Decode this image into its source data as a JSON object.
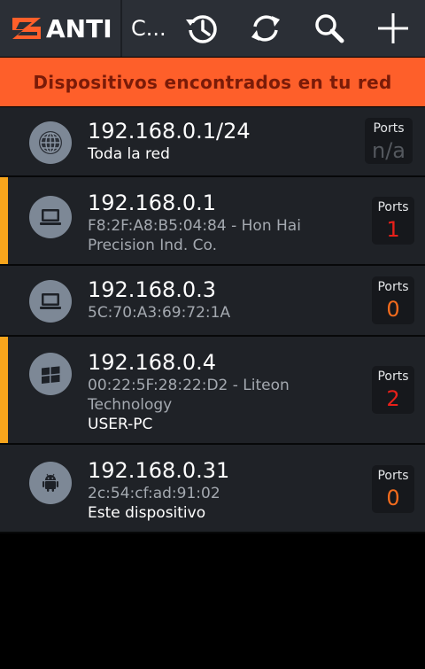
{
  "app": {
    "name": "ANTI",
    "title": "C..."
  },
  "banner": {
    "text": "Dispositivos encontrados en tu red"
  },
  "colors": {
    "accent": "#f7a51c",
    "banner": "#fe5f2a",
    "port_active": "#e8201a",
    "port_zero": "#f26b1d",
    "port_na": "#54585e"
  },
  "ports_label": "Ports",
  "devices": [
    {
      "ip": "192.168.0.1/24",
      "detail": "Toda la red",
      "host": "",
      "ports": "n/a",
      "icon": "globe-icon",
      "flagged": false
    },
    {
      "ip": "192.168.0.1",
      "detail": "F8:2F:A8:B5:04:84 - Hon Hai Precision Ind. Co.",
      "host": "",
      "ports": "1",
      "icon": "computer-icon",
      "flagged": true
    },
    {
      "ip": "192.168.0.3",
      "detail": "5C:70:A3:69:72:1A",
      "host": "",
      "ports": "0",
      "icon": "computer-icon",
      "flagged": false
    },
    {
      "ip": "192.168.0.4",
      "detail": "00:22:5F:28:22:D2 - Liteon Technology",
      "host": "USER-PC",
      "ports": "2",
      "icon": "windows-icon",
      "flagged": true
    },
    {
      "ip": "192.168.0.31",
      "detail": "2c:54:cf:ad:91:02",
      "host": "Este dispositivo",
      "ports": "0",
      "icon": "android-icon",
      "flagged": false
    }
  ]
}
